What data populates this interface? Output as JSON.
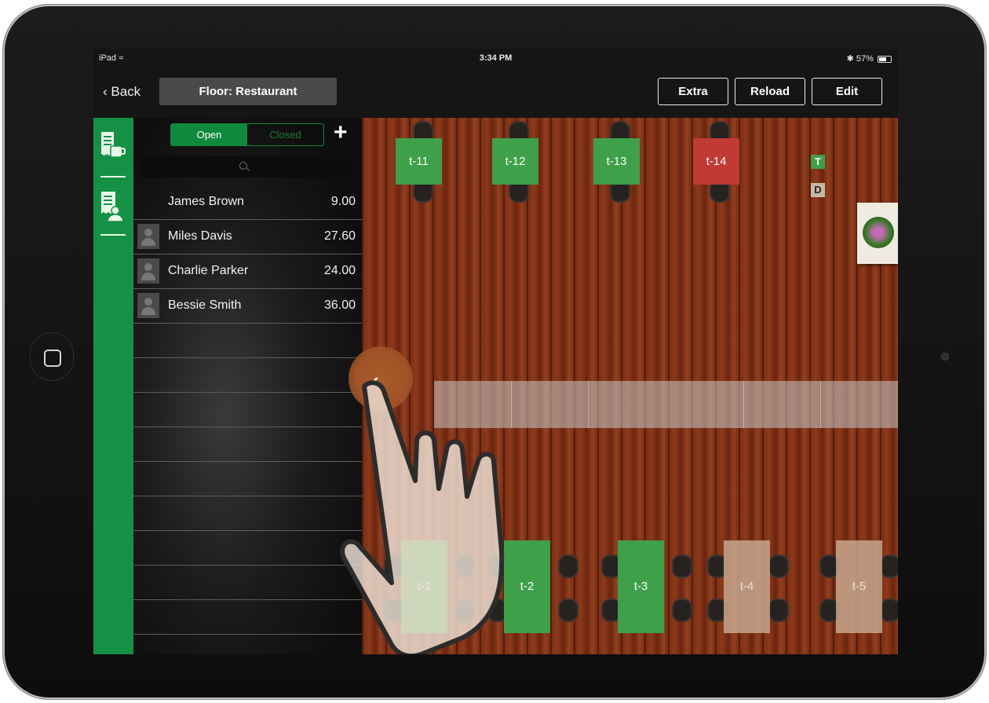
{
  "status_bar": {
    "device": "iPad",
    "time": "3:34 PM",
    "battery": "57%"
  },
  "nav": {
    "back_label": "Back",
    "floor_title": "Floor: Restaurant",
    "buttons": [
      "Extra",
      "Reload",
      "Edit"
    ]
  },
  "segment": {
    "open_label": "Open",
    "closed_label": "Closed",
    "selected": "Open"
  },
  "customers": [
    {
      "name": "James Brown",
      "amount": "9.00",
      "has_avatar": false
    },
    {
      "name": "Miles Davis",
      "amount": "27.60",
      "has_avatar": true
    },
    {
      "name": "Charlie Parker",
      "amount": "24.00",
      "has_avatar": true
    },
    {
      "name": "Bessie Smith",
      "amount": "36.00",
      "has_avatar": true
    }
  ],
  "tables_top": [
    {
      "label": "t-11",
      "status": "free"
    },
    {
      "label": "t-12",
      "status": "free"
    },
    {
      "label": "t-13",
      "status": "free"
    },
    {
      "label": "t-14",
      "status": "occupied"
    }
  ],
  "tables_bottom": [
    {
      "label": "t-1",
      "status": "free"
    },
    {
      "label": "t-2",
      "status": "free"
    },
    {
      "label": "t-3",
      "status": "free"
    },
    {
      "label": "t-4",
      "status": "disabled"
    },
    {
      "label": "t-5",
      "status": "disabled"
    }
  ],
  "badges": {
    "t_label": "T",
    "d_label": "D"
  },
  "colors": {
    "accent_green": "#159145",
    "table_free": "#3fa04a",
    "table_occupied": "#c23a34",
    "table_disabled": "#c7a68d"
  },
  "icons": [
    "receipt-cup-icon",
    "receipt-person-icon",
    "search-icon",
    "plus-icon",
    "back-chevron-icon",
    "collapse-panel-icon",
    "wifi-icon",
    "bluetooth-icon",
    "battery-icon"
  ]
}
